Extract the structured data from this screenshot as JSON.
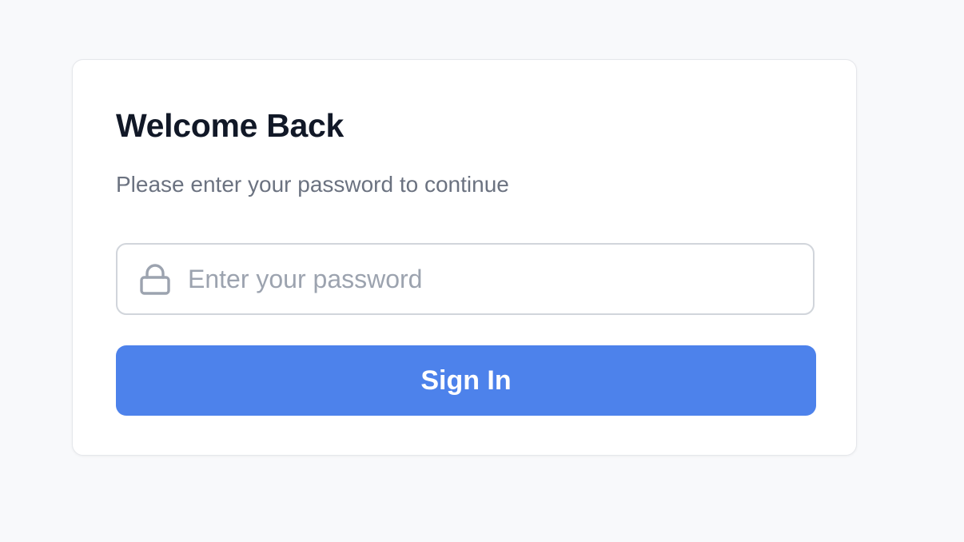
{
  "login": {
    "title": "Welcome Back",
    "subtitle": "Please enter your password to continue",
    "password": {
      "placeholder": "Enter your password",
      "value": "",
      "icon": "lock-icon"
    },
    "submit_label": "Sign In"
  },
  "colors": {
    "background": "#f8f9fb",
    "card": "#ffffff",
    "title": "#111827",
    "subtitle": "#6b7280",
    "placeholder": "#9ca3af",
    "accent": "#4d82eb"
  }
}
